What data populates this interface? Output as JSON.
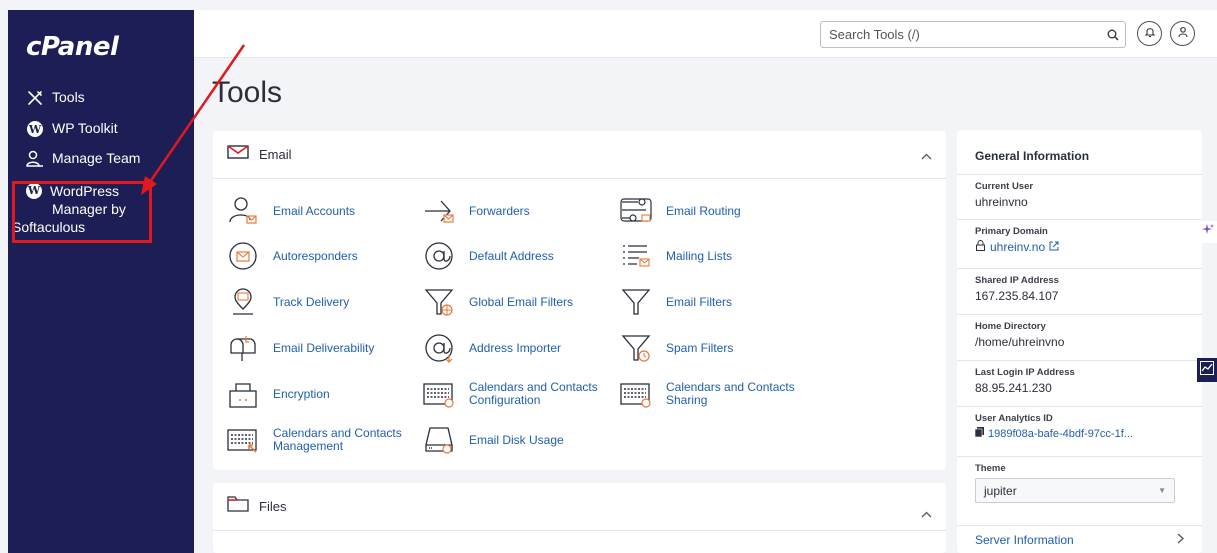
{
  "app": {
    "logo": "cPanel"
  },
  "sidebar": {
    "items": [
      {
        "label": "Tools",
        "icon": "tools-icon"
      },
      {
        "label": "WP Toolkit",
        "icon": "wordpress-icon"
      },
      {
        "label": "Manage Team",
        "icon": "users-icon"
      }
    ],
    "wordpress_manager": {
      "line1": "WordPress",
      "line2": "Manager by",
      "line3": "Softaculous",
      "icon": "wordpress-icon"
    }
  },
  "topbar": {
    "search_placeholder": "Search Tools (/)"
  },
  "page": {
    "title": "Tools"
  },
  "email_panel": {
    "title": "Email",
    "tools": [
      {
        "label": "Email Accounts",
        "icon": "email-accounts-icon"
      },
      {
        "label": "Forwarders",
        "icon": "forwarders-icon"
      },
      {
        "label": "Email Routing",
        "icon": "email-routing-icon"
      },
      {
        "label": "Autoresponders",
        "icon": "autoresponders-icon"
      },
      {
        "label": "Default Address",
        "icon": "at-sign-icon"
      },
      {
        "label": "Mailing Lists",
        "icon": "mailing-lists-icon"
      },
      {
        "label": "Track Delivery",
        "icon": "track-delivery-icon"
      },
      {
        "label": "Global Email Filters",
        "icon": "global-filter-icon"
      },
      {
        "label": "Email Filters",
        "icon": "filter-icon"
      },
      {
        "label": "Email Deliverability",
        "icon": "mailbox-icon"
      },
      {
        "label": "Address Importer",
        "icon": "address-importer-icon"
      },
      {
        "label": "Spam Filters",
        "icon": "spam-filter-icon"
      },
      {
        "label": "Encryption",
        "icon": "encryption-icon"
      },
      {
        "label": "Calendars and Contacts Configuration",
        "icon": "calendar-config-icon"
      },
      {
        "label": "Calendars and Contacts Sharing",
        "icon": "calendar-share-icon"
      },
      {
        "label": "Calendars and Contacts Management",
        "icon": "calendar-manage-icon"
      },
      {
        "label": "Email Disk Usage",
        "icon": "disk-usage-icon"
      }
    ]
  },
  "files_panel": {
    "title": "Files"
  },
  "info": {
    "heading": "General Information",
    "rows": [
      {
        "label": "Current User",
        "value": "uhreinvno"
      },
      {
        "label": "Primary Domain",
        "value": "uhreinv.no"
      },
      {
        "label": "Shared IP Address",
        "value": "167.235.84.107"
      },
      {
        "label": "Home Directory",
        "value": "/home/uhreinvno"
      },
      {
        "label": "Last Login IP Address",
        "value": "88.95.241.230"
      },
      {
        "label": "User Analytics ID",
        "value": "1989f08a-bafe-4bdf-97cc-1f..."
      },
      {
        "label": "Theme",
        "value": "jupiter"
      }
    ],
    "server_info": "Server Information"
  },
  "colors": {
    "sidebar": "#1d1e55",
    "link": "#1f5fad",
    "annotation": "#e0191f",
    "email_accent": "#e8793b"
  }
}
